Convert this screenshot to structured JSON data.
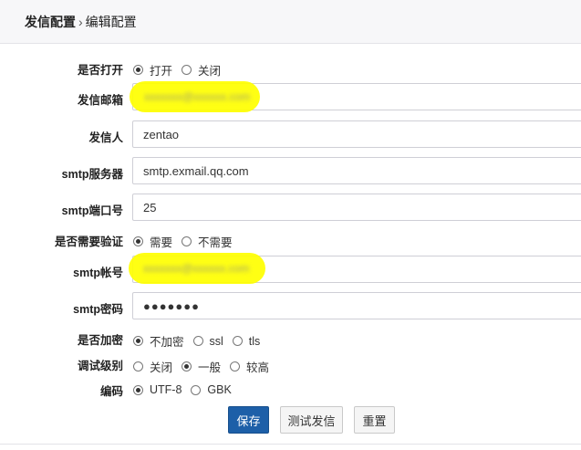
{
  "breadcrumb": {
    "main": "发信配置",
    "separator": "›",
    "current": "编辑配置"
  },
  "form": {
    "enabled": {
      "label": "是否打开",
      "options": [
        "打开",
        "关闭"
      ],
      "selected": 0
    },
    "sender_email": {
      "label": "发信邮箱",
      "value": "xxxxxxx@xxxxxx.com"
    },
    "sender_name": {
      "label": "发信人",
      "value": "zentao"
    },
    "smtp_server": {
      "label": "smtp服务器",
      "value": "smtp.exmail.qq.com"
    },
    "smtp_port": {
      "label": "smtp端口号",
      "value": "25"
    },
    "need_auth": {
      "label": "是否需要验证",
      "options": [
        "需要",
        "不需要"
      ],
      "selected": 0
    },
    "smtp_account": {
      "label": "smtp帐号",
      "value": "xxxxxxx@xxxxxx.com"
    },
    "smtp_password": {
      "label": "smtp密码",
      "value": "●●●●●●●"
    },
    "encryption": {
      "label": "是否加密",
      "options": [
        "不加密",
        "ssl",
        "tls"
      ],
      "selected": 0
    },
    "debug_level": {
      "label": "调试级别",
      "options": [
        "关闭",
        "一般",
        "较高"
      ],
      "selected": 1
    },
    "charset": {
      "label": "编码",
      "options": [
        "UTF-8",
        "GBK"
      ],
      "selected": 0
    }
  },
  "buttons": {
    "save": "保存",
    "test": "测试发信",
    "reset": "重置"
  },
  "colors": {
    "primary_button": "#1d5fa8",
    "highlight": "#ffff00"
  }
}
